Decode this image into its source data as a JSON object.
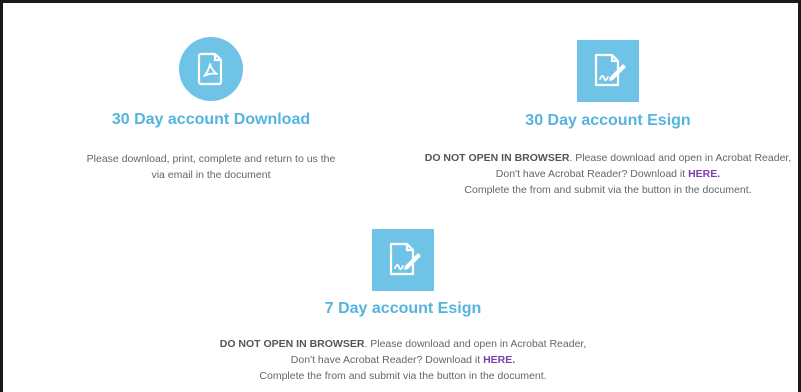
{
  "accent_color": "#6fc3e6",
  "title_color": "#55b4df",
  "link_color": "#7b3fb0",
  "cards": [
    {
      "icon": "pdf-document-icon",
      "title": "30 Day account Download",
      "line1": "Please download, print, complete and return to us the",
      "line2": "via email in the document"
    },
    {
      "icon": "sign-document-icon",
      "title": "30 Day account Esign",
      "warning": "DO NOT OPEN IN BROWSER",
      "line1_rest": ". Please download and open in Acrobat Reader,",
      "line2_prefix": "Don't have Acrobat Reader? Download it ",
      "link": "HERE.",
      "line3": "Complete the from and submit via the button in the document."
    },
    {
      "icon": "sign-document-icon",
      "title": "7 Day account Esign",
      "warning": "DO NOT OPEN IN BROWSER",
      "line1_rest": ". Please download and open in Acrobat Reader,",
      "line2_prefix": "Don't have Acrobat Reader? Download it ",
      "link": "HERE.",
      "line3": "Complete the from and submit via the button in the document."
    }
  ]
}
